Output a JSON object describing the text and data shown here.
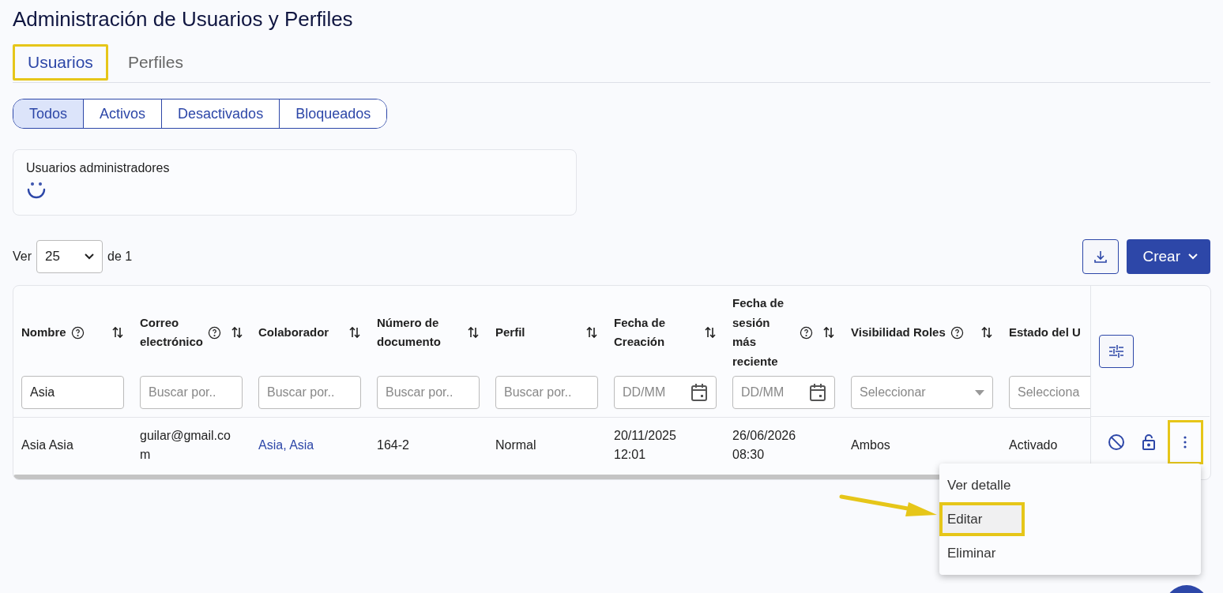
{
  "title": "Administración de Usuarios y Perfiles",
  "tabs": [
    {
      "label": "Usuarios",
      "selected": true,
      "highlighted": true
    },
    {
      "label": "Perfiles",
      "selected": false,
      "highlighted": false
    }
  ],
  "status_filters": [
    {
      "label": "Todos",
      "selected": true
    },
    {
      "label": "Activos",
      "selected": false
    },
    {
      "label": "Desactivados",
      "selected": false
    },
    {
      "label": "Bloqueados",
      "selected": false
    }
  ],
  "admin_card": {
    "title": "Usuarios administradores",
    "loading": true
  },
  "pagination": {
    "label_before": "Ver",
    "page_size": "25",
    "label_after": "de 1"
  },
  "create_button": "Crear",
  "table": {
    "columns": [
      {
        "label": "Nombre",
        "help": true,
        "filter": {
          "kind": "text",
          "value": "Asia"
        }
      },
      {
        "label": "Correo electrónico",
        "help": true,
        "filter": {
          "kind": "text",
          "placeholder": "Buscar por.."
        }
      },
      {
        "label": "Colaborador",
        "help": false,
        "filter": {
          "kind": "text",
          "placeholder": "Buscar por.."
        }
      },
      {
        "label": "Número de documento",
        "help": false,
        "filter": {
          "kind": "text",
          "placeholder": "Buscar por.."
        }
      },
      {
        "label": "Perfil",
        "help": false,
        "filter": {
          "kind": "text",
          "placeholder": "Buscar por.."
        }
      },
      {
        "label": "Fecha de Creación",
        "help": false,
        "filter": {
          "kind": "date",
          "placeholder": "DD/MM"
        }
      },
      {
        "label": "Fecha de sesión más reciente",
        "help": true,
        "filter": {
          "kind": "date",
          "placeholder": "DD/MM"
        }
      },
      {
        "label": "Visibilidad Roles",
        "help": true,
        "filter": {
          "kind": "select",
          "placeholder": "Seleccionar"
        }
      },
      {
        "label": "Estado del U",
        "help": false,
        "filter": {
          "kind": "select",
          "placeholder": "Selecciona"
        }
      }
    ],
    "rows": [
      {
        "cells": [
          {
            "kind": "text",
            "text": "Asia Asia",
            "redacted": false
          },
          {
            "kind": "email",
            "text": "guilar@gmail.com",
            "redacted": false
          },
          {
            "kind": "link",
            "text": "Asia, Asia",
            "redacted": false
          },
          {
            "kind": "text",
            "text": "164-2",
            "redacted": false
          },
          {
            "kind": "text",
            "text": "Normal",
            "redacted": false
          },
          {
            "kind": "text",
            "text": "20/11/2025 12:01",
            "redacted": false
          },
          {
            "kind": "text",
            "text": "26/06/2026 08:30",
            "redacted": false
          },
          {
            "kind": "text",
            "text": "Ambos",
            "redacted": false
          },
          {
            "kind": "text",
            "text": "Activado",
            "redacted": false
          }
        ],
        "menu_highlighted": true
      }
    ]
  },
  "row_menu": {
    "items": [
      {
        "label": "Ver detalle",
        "hovered": false,
        "highlighted": false
      },
      {
        "label": "Editar",
        "hovered": true,
        "highlighted": true
      },
      {
        "label": "Eliminar",
        "hovered": false,
        "highlighted": false
      }
    ]
  },
  "annotation_arrow": true
}
